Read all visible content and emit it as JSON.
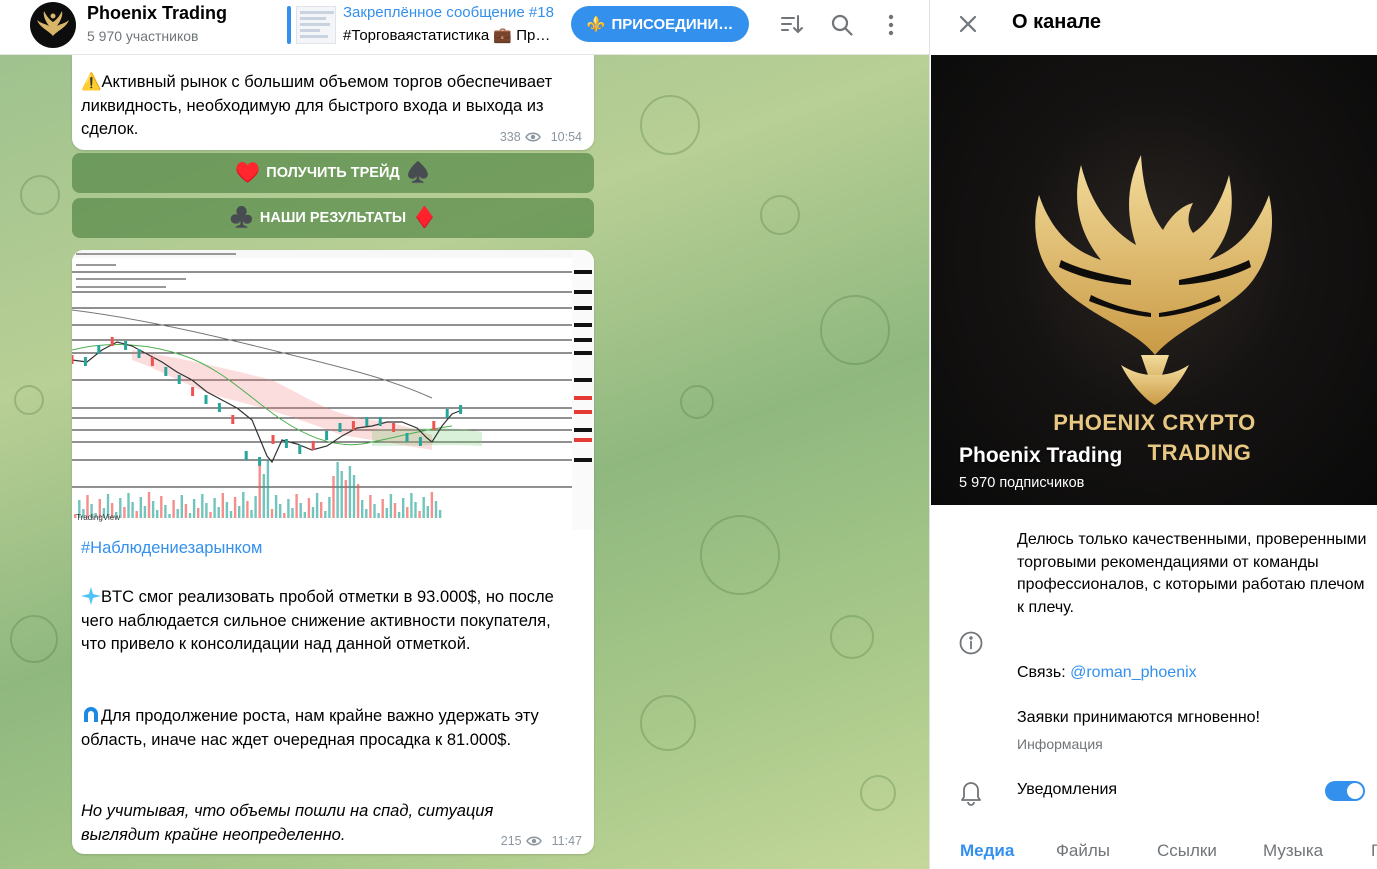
{
  "chat": {
    "title": "Phoenix Trading",
    "subtitle": "5 970 участников",
    "pinned_title": "Закреплённое сообщение #18",
    "pinned_text": "#Торговаястатистика 💼 Пр…",
    "join_label": "ПРИСОЕДИНИ…",
    "join_icon": "⚜️"
  },
  "messages": {
    "m1": {
      "icon": "⚠️",
      "text": "Активный рынок с большим объемом торгов обеспечивает ликвидность, необходимую для быстрого входа и выхода из сделок.",
      "views": "338",
      "time": "10:54"
    },
    "btn1": {
      "left": "♥️",
      "label": "ПОЛУЧИТЬ ТРЕЙД",
      "right": "♠️"
    },
    "btn2": {
      "left": "♣️",
      "label": "НАШИ РЕЗУЛЬТАТЫ",
      "right": "♦️"
    },
    "m2": {
      "hashtag": "#Наблюдениезарынком",
      "p1": "BTC смог реализовать пробой отметки в 93.000$, но после чего наблюдается сильное снижение активности покупателя, что привело к консолидации над данной отметкой.",
      "p2": "Для продолжение роста, нам крайне важно удержать эту область, иначе нас ждет очередная просадка к 81.000$.",
      "p3": "Но учитывая, что объемы пошли на спад, ситуация выглядит крайне неопределенно.",
      "views": "215",
      "time": "11:47",
      "chart_caption": "TradingView"
    }
  },
  "info": {
    "header": "О канале",
    "cover_brand_1": "PHOENIX CRYPTO",
    "cover_brand_2": "TRADING",
    "name": "Phoenix Trading",
    "subscribers": "5 970 подписчиков",
    "about": "Делюсь только качественными, проверенными торговыми рекомендациями от команды профессионалов, с которыми работаю плечом к плечу.",
    "contact_label": "Связь:",
    "contact_handle": "@roman_phoenix",
    "accept": "Заявки принимаются мгновенно!",
    "info_label": "Информация",
    "notifications": "Уведомления",
    "notifications_on": true
  },
  "tabs": [
    "Медиа",
    "Файлы",
    "Ссылки",
    "Музыка",
    "Г"
  ],
  "colors": {
    "accent": "#3390ec",
    "gold": "#e7c782",
    "button_green": "#49803e"
  }
}
